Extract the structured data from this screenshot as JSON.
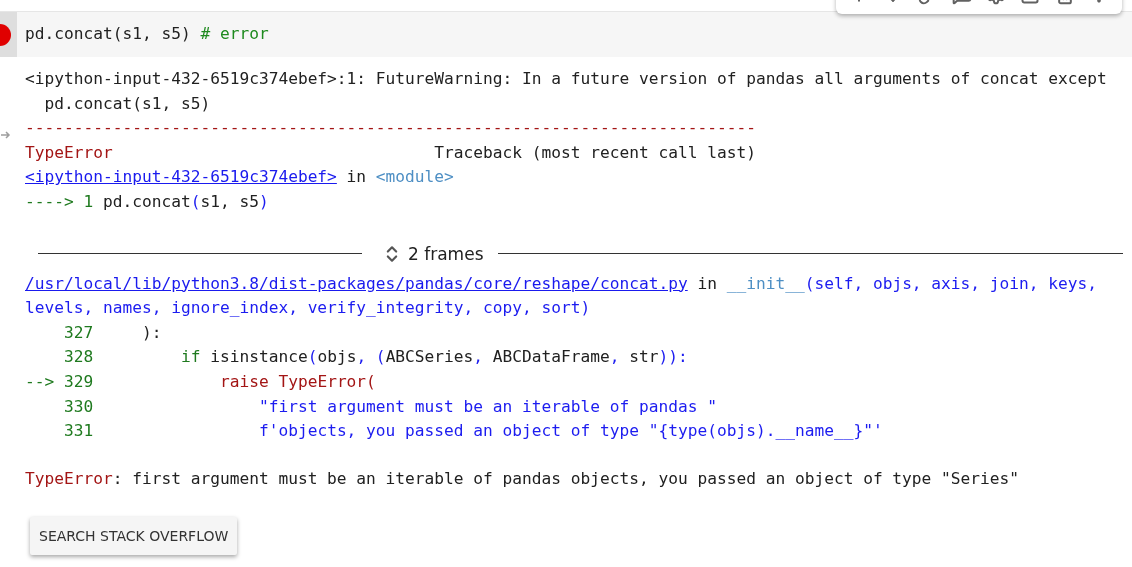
{
  "cell": {
    "failed": true,
    "code": [
      {
        "kind": "plain",
        "text": "pd.concat(s1, s5) "
      },
      {
        "kind": "comment",
        "text": "# error"
      }
    ]
  },
  "output": {
    "head_lines": [
      {
        "tokens": [
          {
            "kind": "plain",
            "text": "<ipython-input-432-6519c374ebef>:1: FutureWarning: In a future version of pandas all arguments of concat except"
          }
        ]
      },
      {
        "tokens": [
          {
            "kind": "plain",
            "text": "  pd.concat(s1, s5)"
          }
        ]
      },
      {
        "tokens": [
          {
            "kind": "error",
            "text": "---------------------------------------------------------------------------"
          }
        ]
      },
      {
        "tokens": [
          {
            "kind": "error",
            "text": "TypeError"
          },
          {
            "kind": "plain",
            "text": "                                 Traceback (most recent call last)"
          }
        ]
      },
      {
        "tokens": [
          {
            "kind": "link",
            "text": "<ipython-input-432-6519c374ebef>"
          },
          {
            "kind": "plain",
            "text": " in "
          },
          {
            "kind": "name",
            "text": "<module>"
          }
        ]
      },
      {
        "tokens": [
          {
            "kind": "lineno",
            "text": "----> 1 "
          },
          {
            "kind": "plain",
            "text": "pd.concat"
          },
          {
            "kind": "blue",
            "text": "("
          },
          {
            "kind": "plain",
            "text": "s1, s5"
          },
          {
            "kind": "blue",
            "text": ")"
          }
        ]
      }
    ],
    "frames_toggle": {
      "label": "2 frames"
    },
    "frame_lines": [
      {
        "tokens": [
          {
            "kind": "link",
            "text": "/usr/local/lib/python3.8/dist-packages/pandas/core/reshape/concat.py"
          },
          {
            "kind": "plain",
            "text": " in "
          },
          {
            "kind": "name",
            "text": "__init__"
          },
          {
            "kind": "blue",
            "text": "(self, objs, axis, join, keys,"
          }
        ]
      },
      {
        "tokens": [
          {
            "kind": "blue",
            "text": "levels, names, ignore_index, verify_integrity, copy, sort)"
          }
        ]
      },
      {
        "tokens": [
          {
            "kind": "lineno",
            "text": "    327"
          },
          {
            "kind": "plain",
            "text": "     ):"
          }
        ]
      },
      {
        "tokens": [
          {
            "kind": "lineno",
            "text": "    328"
          },
          {
            "kind": "lineno",
            "text": "         if"
          },
          {
            "kind": "plain",
            "text": " isinstance"
          },
          {
            "kind": "blue",
            "text": "("
          },
          {
            "kind": "plain",
            "text": "objs"
          },
          {
            "kind": "blue",
            "text": ", ("
          },
          {
            "kind": "plain",
            "text": "ABCSeries"
          },
          {
            "kind": "blue",
            "text": ", "
          },
          {
            "kind": "plain",
            "text": "ABCDataFrame"
          },
          {
            "kind": "blue",
            "text": ", "
          },
          {
            "kind": "plain",
            "text": "str"
          },
          {
            "kind": "blue",
            "text": ")):"
          }
        ]
      },
      {
        "tokens": [
          {
            "kind": "lineno",
            "text": "--> 329"
          },
          {
            "kind": "error",
            "text": "             raise TypeError("
          }
        ]
      },
      {
        "tokens": [
          {
            "kind": "lineno",
            "text": "    330"
          },
          {
            "kind": "blue",
            "text": "                 \"first argument must be an iterable of pandas \""
          }
        ]
      },
      {
        "tokens": [
          {
            "kind": "lineno",
            "text": "    331"
          },
          {
            "kind": "blue",
            "text": "                 f'objects, you passed an object of type \"{type(objs).__name__}\"'"
          }
        ]
      }
    ],
    "error_message": [
      {
        "kind": "error",
        "text": "TypeError"
      },
      {
        "kind": "plain",
        "text": ": first argument must be an iterable of pandas objects, you passed an object of type \"Series\""
      }
    ],
    "search_button": "SEARCH STACK OVERFLOW"
  }
}
